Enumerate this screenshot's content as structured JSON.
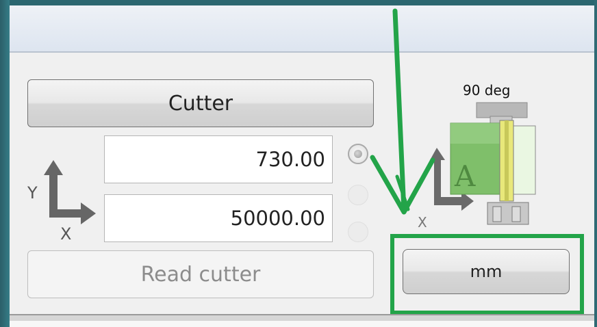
{
  "cutter": {
    "title_button": "Cutter",
    "read_button": "Read cutter",
    "y_value": "730.00",
    "x_value": "50000.00"
  },
  "axes_small": {
    "y": "Y",
    "x": "X"
  },
  "axes_diagram": {
    "x": "X"
  },
  "orientation": {
    "angle_label": "90 deg",
    "tool_letter": "A"
  },
  "units": {
    "button_label": "mm"
  },
  "radio_group": {
    "selected_index": 0,
    "count": 3
  },
  "colors": {
    "annotation_green": "#23a449",
    "axis_arrow": "#666666",
    "tool_green": "#7fbf6a"
  },
  "icons": [
    "xy-axes-icon",
    "orientation-tool-icon",
    "annotation-arrow"
  ]
}
